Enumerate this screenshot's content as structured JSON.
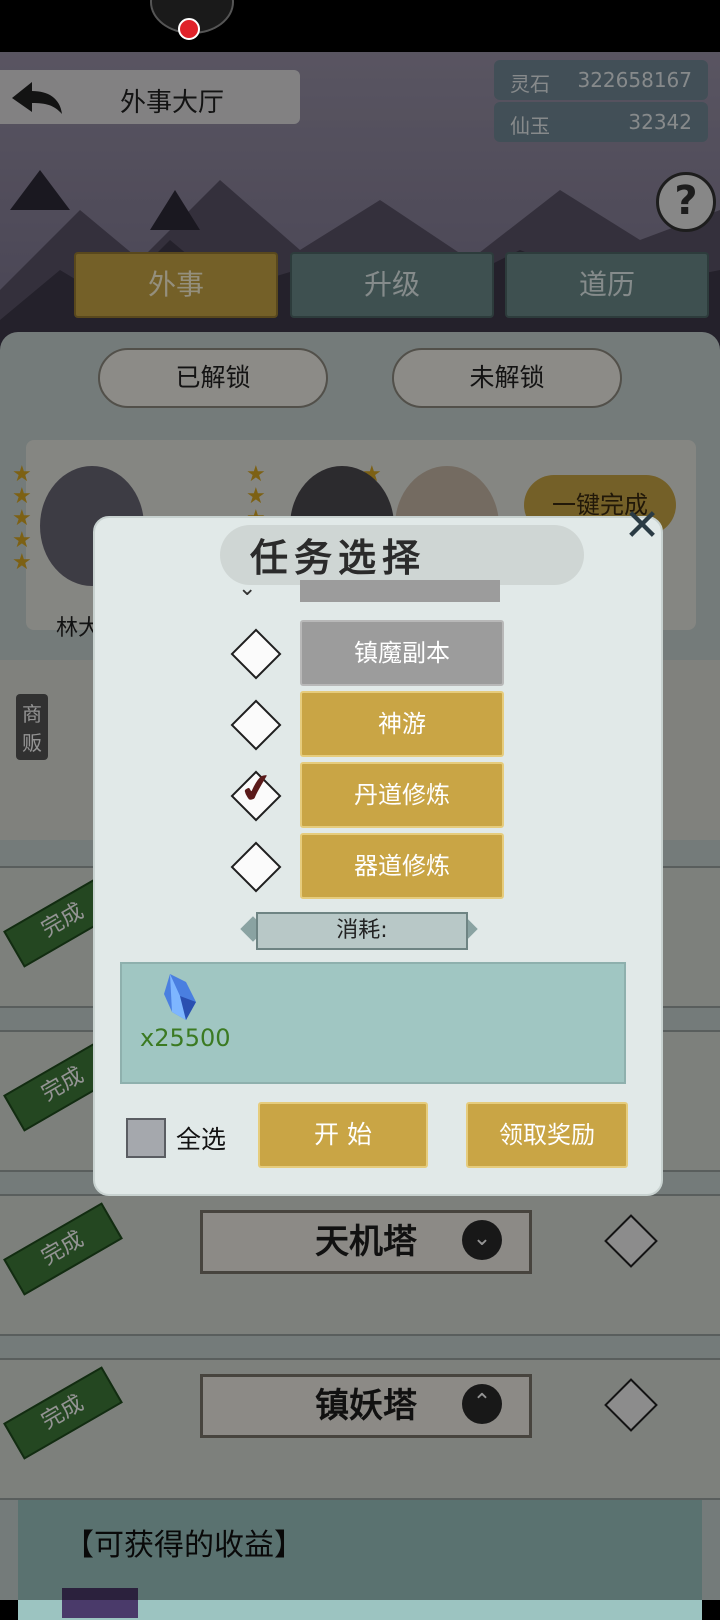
{
  "header": {
    "title": "外事大厅",
    "resources": [
      {
        "label": "灵石",
        "value": "322658167"
      },
      {
        "label": "仙玉",
        "value": "32342"
      }
    ],
    "help_glyph": "?"
  },
  "main_tabs": [
    {
      "label": "外事",
      "active": true
    },
    {
      "label": "升级",
      "active": false
    },
    {
      "label": "道历",
      "active": false
    }
  ],
  "sub_tabs": [
    {
      "label": "已解锁"
    },
    {
      "label": "未解锁"
    }
  ],
  "characters": {
    "name": "林大",
    "one_key_label": "一键完成"
  },
  "shop": {
    "label": "商贩"
  },
  "task_cards": [
    {
      "stamp": "完成",
      "tower": "",
      "toggle": ""
    },
    {
      "stamp": "完成",
      "tower": "",
      "toggle": ""
    },
    {
      "stamp": "完成",
      "tower": "天机塔",
      "toggle": "⌄"
    },
    {
      "stamp": "完成",
      "tower": "镇妖塔",
      "toggle": "⌃"
    }
  ],
  "income": {
    "title": "【可获得的收益】"
  },
  "modal": {
    "title": "任务选择",
    "close_glyph": "✕",
    "tasks": [
      {
        "label": "镇魔副本",
        "style": "grey",
        "checked": false
      },
      {
        "label": "神游",
        "style": "gold",
        "checked": false
      },
      {
        "label": "丹道修炼",
        "style": "gold",
        "checked": true
      },
      {
        "label": "器道修炼",
        "style": "gold",
        "checked": false
      }
    ],
    "cost_label": "消耗:",
    "cost_amount": "x25500",
    "select_all_label": "全选",
    "start_label": "开 始",
    "reward_label": "领取奖励"
  },
  "colors": {
    "gold_button": "#c9a545",
    "grey_button": "#9c9c9c",
    "teal_tab": "#6b8a8a",
    "done_green": "#3f7a3a"
  },
  "icons": [
    "back-arrow-icon",
    "help-icon",
    "close-icon",
    "crystal-icon",
    "check-icon",
    "diamond-checkbox-icon"
  ]
}
